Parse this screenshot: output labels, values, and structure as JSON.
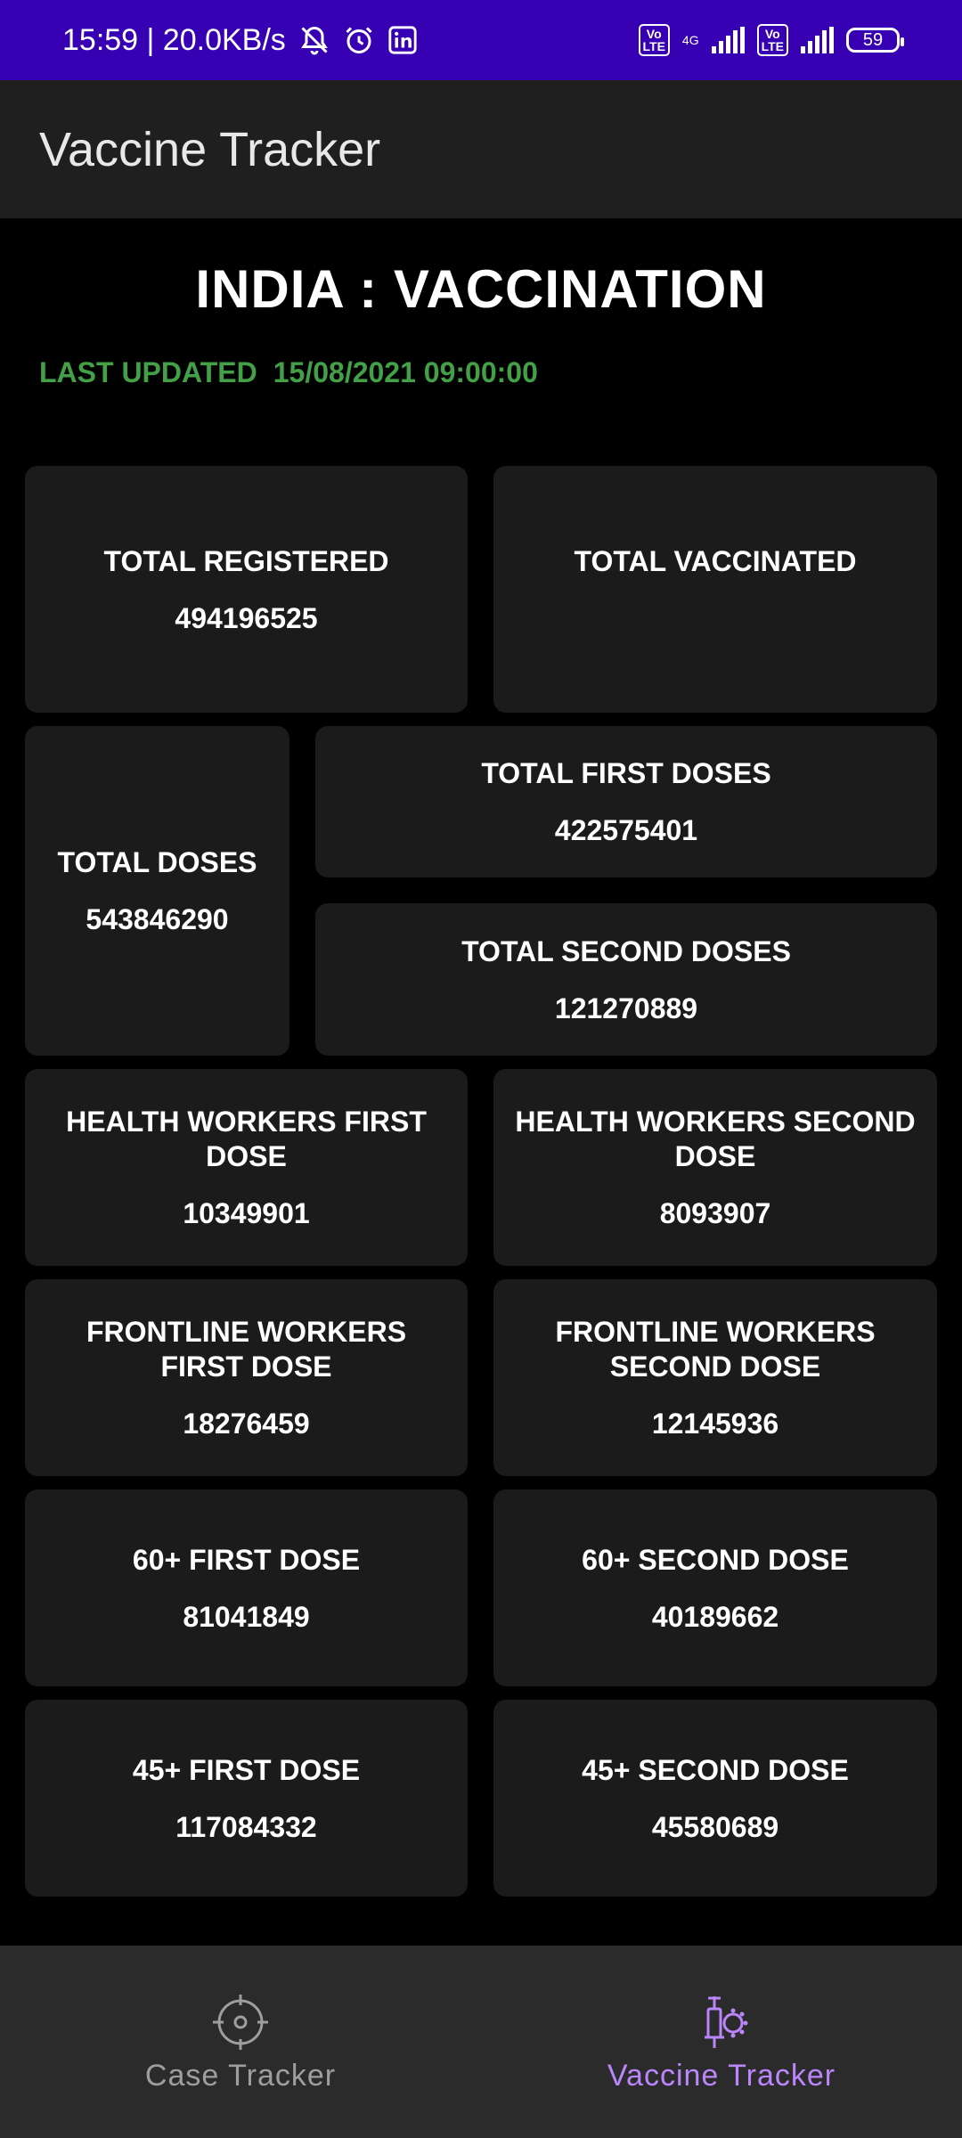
{
  "status_bar": {
    "time_speed": "15:59 | 20.0KB/s",
    "network": "4G",
    "volte_1": "Vo\nLTE",
    "volte_2": "Vo\nLTE",
    "battery": "59"
  },
  "app_bar": {
    "title": "Vaccine Tracker"
  },
  "header": {
    "title": "INDIA : VACCINATION",
    "last_updated_label": "LAST UPDATED",
    "last_updated_value": "15/08/2021 09:00:00"
  },
  "cards": {
    "total_registered": {
      "label": "TOTAL REGISTERED",
      "value": "494196525"
    },
    "total_vaccinated": {
      "label": "TOTAL VACCINATED",
      "value": ""
    },
    "total_doses": {
      "label": "TOTAL DOSES",
      "value": "543846290"
    },
    "total_first_doses": {
      "label": "TOTAL FIRST DOSES",
      "value": "422575401"
    },
    "total_second_doses": {
      "label": "TOTAL SECOND DOSES",
      "value": "121270889"
    },
    "hw_first": {
      "label": "HEALTH WORKERS FIRST DOSE",
      "value": "10349901"
    },
    "hw_second": {
      "label": "HEALTH WORKERS SECOND DOSE",
      "value": "8093907"
    },
    "fw_first": {
      "label": "FRONTLINE WORKERS FIRST DOSE",
      "value": "18276459"
    },
    "fw_second": {
      "label": "FRONTLINE WORKERS SECOND DOSE",
      "value": "12145936"
    },
    "age60_first": {
      "label": "60+ FIRST DOSE",
      "value": "81041849"
    },
    "age60_second": {
      "label": "60+ SECOND DOSE",
      "value": "40189662"
    },
    "age45_first": {
      "label": "45+ FIRST DOSE",
      "value": "117084332"
    },
    "age45_second": {
      "label": "45+ SECOND DOSE",
      "value": "45580689"
    }
  },
  "bottom_nav": {
    "items": [
      {
        "label": "Case Tracker",
        "icon": "crosshair-icon",
        "active": false
      },
      {
        "label": "Vaccine Tracker",
        "icon": "vaccine-syringe-icon",
        "active": true
      }
    ]
  },
  "colors": {
    "status_bar": "#3700b3",
    "app_bar": "#1f1f1f",
    "card": "#1b1b1b",
    "last_updated": "#43a047",
    "nav_active": "#bb86fc",
    "nav_inactive": "#9e9e9e"
  }
}
